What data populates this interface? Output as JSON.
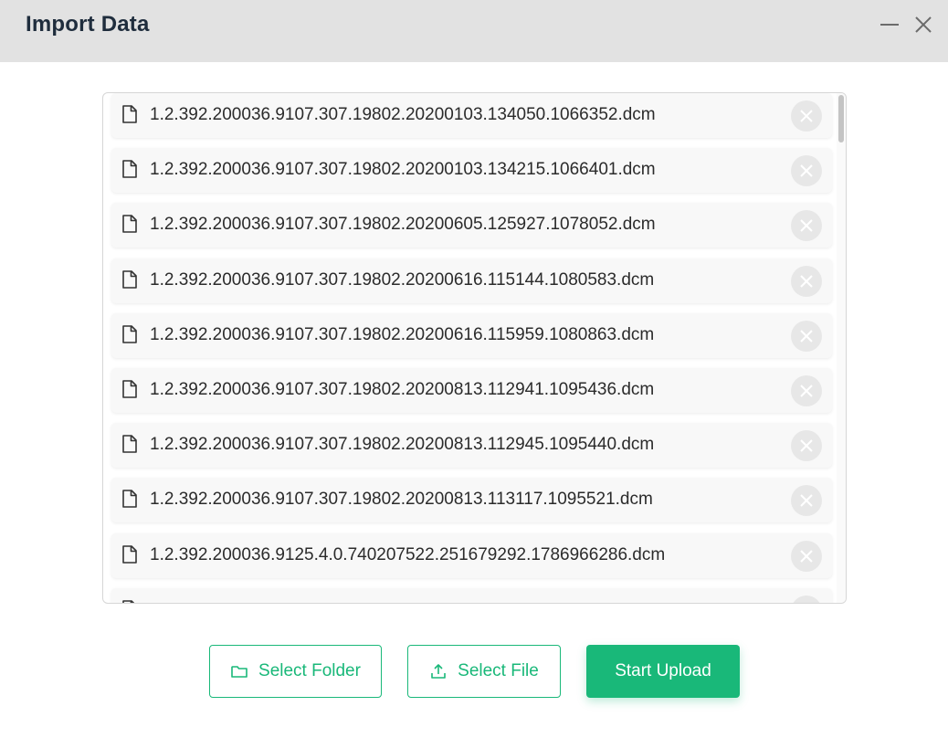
{
  "window": {
    "title": "Import Data"
  },
  "files": [
    {
      "name": "1.2.392.200036.9107.307.19802.20200103.134050.1066352.dcm"
    },
    {
      "name": "1.2.392.200036.9107.307.19802.20200103.134215.1066401.dcm"
    },
    {
      "name": "1.2.392.200036.9107.307.19802.20200605.125927.1078052.dcm"
    },
    {
      "name": "1.2.392.200036.9107.307.19802.20200616.115144.1080583.dcm"
    },
    {
      "name": "1.2.392.200036.9107.307.19802.20200616.115959.1080863.dcm"
    },
    {
      "name": "1.2.392.200036.9107.307.19802.20200813.112941.1095436.dcm"
    },
    {
      "name": "1.2.392.200036.9107.307.19802.20200813.112945.1095440.dcm"
    },
    {
      "name": "1.2.392.200036.9107.307.19802.20200813.113117.1095521.dcm"
    },
    {
      "name": "1.2.392.200036.9125.4.0.740207522.251679292.1786966286.dcm"
    },
    {
      "name": ""
    }
  ],
  "actions": {
    "select_folder": "Select Folder",
    "select_file": "Select File",
    "start_upload": "Start Upload"
  },
  "colors": {
    "accent": "#19b879",
    "titlebar": "#e2e2e2"
  },
  "icons": {
    "file": "file-icon",
    "remove": "close-circle-icon",
    "folder": "folder-icon",
    "upload": "upload-icon",
    "minimize": "minimize-icon",
    "close": "close-icon"
  }
}
